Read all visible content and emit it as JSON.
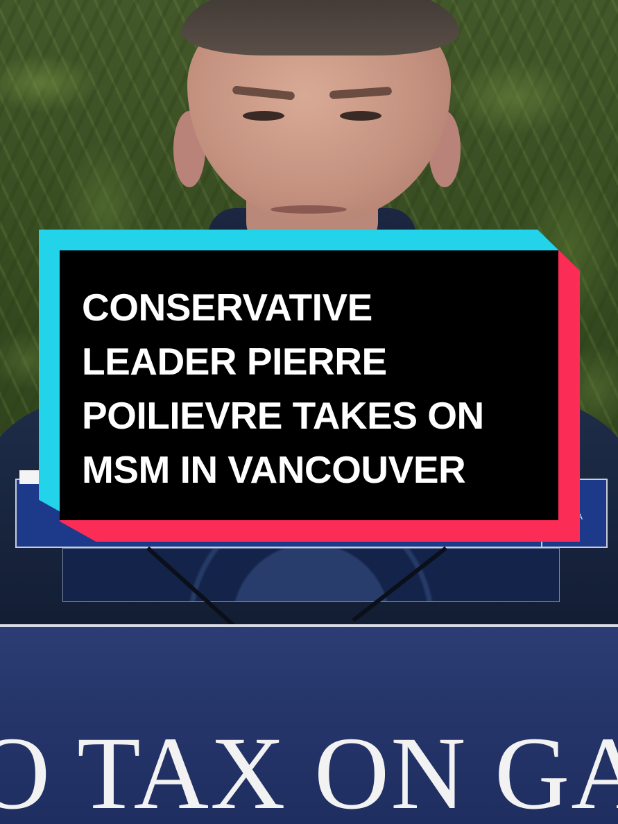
{
  "headline": {
    "lines": [
      "CONSERVATIVE",
      "LEADER PIERRE",
      "POILIEVRE TAKES ON",
      "MSM IN VANCOUVER"
    ]
  },
  "podium": {
    "sign_text": "O TAX ON GA"
  },
  "screen": {
    "corner_text": "A"
  },
  "colors": {
    "card_cyan": "#22d3e9",
    "card_red": "#fb2c55",
    "card_black": "#000000",
    "podium_blue": "#25356a",
    "foliage_green": "#34481f"
  }
}
